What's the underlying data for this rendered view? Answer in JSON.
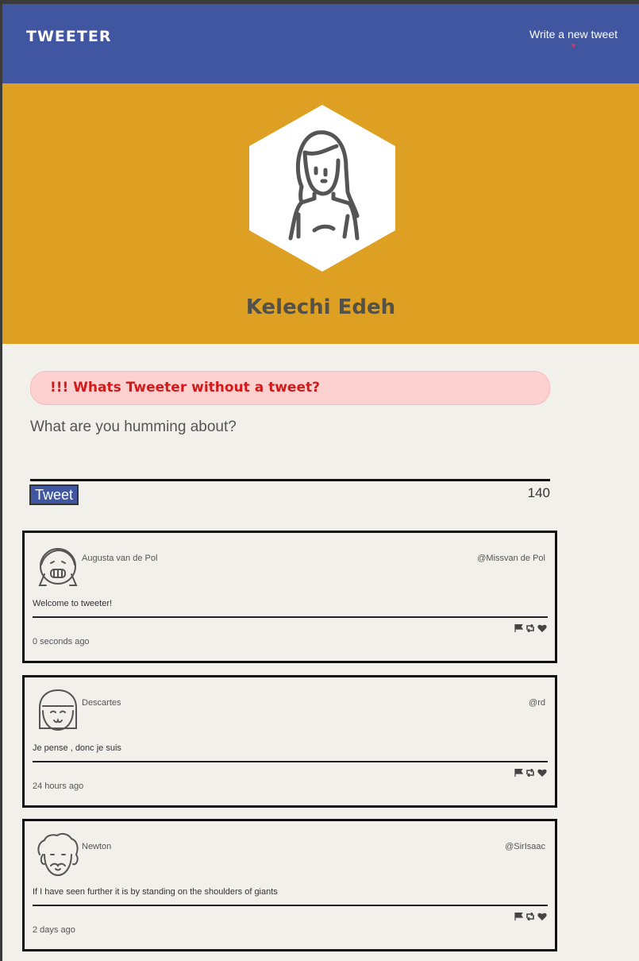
{
  "nav": {
    "brand": "TWEETER",
    "compose_label": "Write a new tweet",
    "compose_arrow": "▼"
  },
  "profile": {
    "name": "Kelechi Edeh"
  },
  "compose": {
    "error": "!!! Whats Tweeter without a tweet?",
    "placeholder": "What are you humming about?",
    "button_label": "Tweet",
    "counter": "140"
  },
  "tweets": [
    {
      "name": "Augusta van de Pol",
      "handle": "@Missvan de Pol",
      "content": "Welcome to tweeter!",
      "time": "0 seconds ago"
    },
    {
      "name": "Descartes",
      "handle": "@rd",
      "content": "Je pense , donc je suis",
      "time": "24 hours ago"
    },
    {
      "name": "Newton",
      "handle": "@SirIsaac",
      "content": "If I have seen further it is by standing on the shoulders of giants",
      "time": "2 days ago"
    }
  ],
  "colors": {
    "nav": "#4056a1",
    "profile": "#dda022",
    "page": "#f1f0eb",
    "error_bg": "#fed1d1",
    "error_text": "#d21a1a"
  },
  "icons": [
    "flag-icon",
    "retweet-icon",
    "heart-icon"
  ]
}
